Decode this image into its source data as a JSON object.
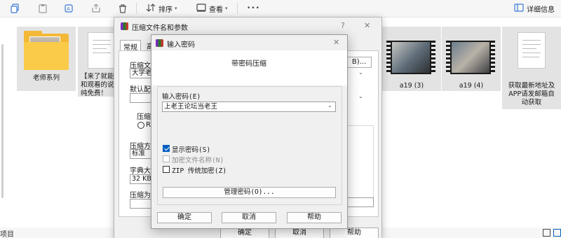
{
  "toolbar": {
    "sort_label": "排序",
    "view_label": "查看",
    "more_label": "•••",
    "details_label": "详细信息"
  },
  "files": [
    {
      "label": "老师系列",
      "kind": "folder"
    },
    {
      "label": "【来了就能看到",
      "label2": "和观看的说",
      "label3": "纯免费！",
      "kind": "document"
    },
    {
      "label": "a19 (3)",
      "kind": "video"
    },
    {
      "label": "a19 (4)",
      "kind": "video"
    },
    {
      "label": "获取最新地址及",
      "label2": "APP请发邮箱自",
      "label3": "动获取",
      "kind": "document"
    }
  ],
  "status": {
    "text": "项目"
  },
  "archive_dialog": {
    "title": "压缩文件名和参数",
    "help_char": "?",
    "close_char": "✕",
    "tabs": [
      "常规",
      "高"
    ],
    "archive_name_label": "压缩文",
    "archive_name_value": "大学老",
    "browse_label": "B)...",
    "default_profile_label": "默认配",
    "format_label": "压缩文",
    "format_option": "RA",
    "method_label": "压缩方",
    "method_value": "标准",
    "dict_label": "字典大",
    "dict_value": "32 KB",
    "split_label": "压缩为",
    "ok_label": "确定",
    "cancel_label": "取消",
    "help_label": "帮助"
  },
  "password_dialog": {
    "title": "输入密码",
    "close_char": "✕",
    "heading": "带密码压缩",
    "password_label": "输入密码(E)",
    "password_value": "上老王论坛当老王",
    "show_password_label": "显示密码(S)",
    "show_password_checked": true,
    "encrypt_names_label": "加密文件名称(N)",
    "encrypt_names_checked": false,
    "zip_legacy_label": "ZIP 传统加密(Z)",
    "zip_legacy_checked": false,
    "manage_label": "管理密码(O)...",
    "ok_label": "确定",
    "cancel_label": "取消",
    "help_label": "帮助"
  }
}
